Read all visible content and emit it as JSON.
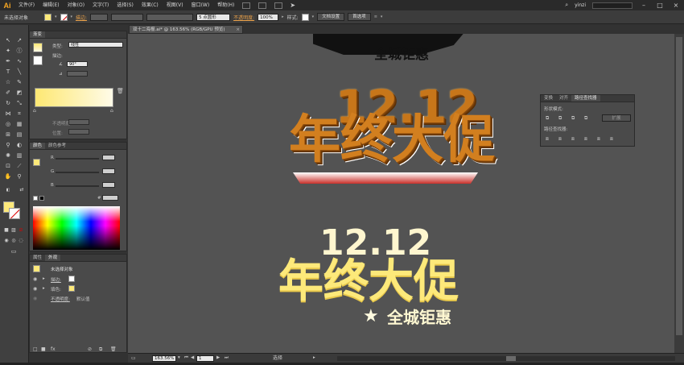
{
  "menubar": {
    "app": "Ai",
    "items": [
      "文件(F)",
      "编辑(E)",
      "对象(O)",
      "文字(T)",
      "选择(S)",
      "效果(C)",
      "视图(V)",
      "窗口(W)",
      "帮助(H)"
    ],
    "user": "yinzi"
  },
  "controlbar": {
    "selection": "未选择对象",
    "stroke_label": "描边:",
    "stroke_style": "5 点圆形",
    "opacity_label": "不透明度:",
    "opacity_value": "100%",
    "style_label": "样式:",
    "doc_setup": "文档设置",
    "preferences": "首选项"
  },
  "gradient_panel": {
    "tab": "渐变",
    "type_label": "类型:",
    "type_value": "线性",
    "stroke_label": "描边:",
    "angle_value": "90°",
    "opacity_label": "不透明度:",
    "location_label": "位置:",
    "colors": {
      "start": "#fde873",
      "end": "#fffbe8"
    }
  },
  "color_panel": {
    "tabs": [
      "颜色",
      "颜色参考"
    ],
    "channels": [
      "R",
      "G",
      "B"
    ],
    "hex_label": "#"
  },
  "appearance_panel": {
    "tabs": [
      "属性",
      "外观"
    ],
    "title": "未选择对象",
    "rows": [
      {
        "label": "描边:"
      },
      {
        "label": "填色:"
      },
      {
        "label": "不透明度:",
        "value": "默认值"
      }
    ]
  },
  "pathfinder_panel": {
    "tabs": [
      "变换",
      "对齐",
      "路径查找器"
    ],
    "shape_modes": "形状模式:",
    "expand": "扩展",
    "pathfinders": "路径查找器:"
  },
  "document": {
    "tab": "双十二海报.ai* @ 163.56% (RGB/GPU 预览)"
  },
  "artwork": {
    "top_partial": "全城钜惠",
    "title_3d": "年终大促",
    "date": "12.12",
    "title_flat": "年终大促",
    "subtitle": "全城钜惠",
    "star": "★"
  },
  "statusbar": {
    "zoom": "163.56%",
    "page": "1",
    "tool": "选择"
  },
  "colors": {
    "accent_yellow": "#fde97a",
    "orange_3d": "#c7761a",
    "canvas": "#535353"
  }
}
